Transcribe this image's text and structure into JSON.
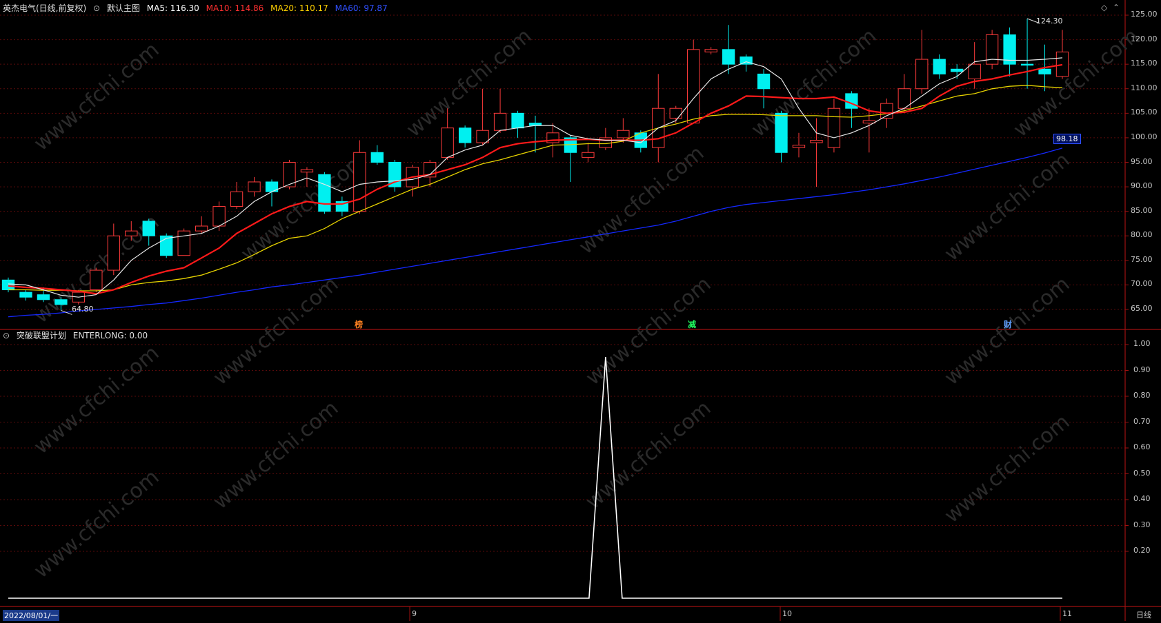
{
  "header": {
    "stock": "英杰电气(日线,前复权)",
    "indicator_name": "默认主图",
    "ma5": {
      "label": "MA5: 116.30",
      "color": "#ffffff"
    },
    "ma10": {
      "label": "MA10: 114.86",
      "color": "#ff2020"
    },
    "ma20": {
      "label": "MA20: 110.17",
      "color": "#ffd000"
    },
    "ma60": {
      "label": "MA60: 97.87",
      "color": "#2040ff"
    }
  },
  "sub_header": {
    "indicator": "突破联盟计划",
    "value_label": "ENTERLONG: 0.00"
  },
  "markers": {
    "high": "124.30",
    "low": "64.80",
    "current_price": "98.18"
  },
  "event_tags": [
    "榜",
    "减",
    "财"
  ],
  "price_axis": [
    "125.00",
    "120.00",
    "115.00",
    "110.00",
    "105.00",
    "100.00",
    "95.00",
    "90.00",
    "85.00",
    "80.00",
    "75.00",
    "70.00",
    "65.00"
  ],
  "indicator_axis": [
    "1.00",
    "0.90",
    "0.80",
    "0.70",
    "0.60",
    "0.50",
    "0.40",
    "0.30",
    "0.20"
  ],
  "date_axis": {
    "start": "2022/08/01/一",
    "m9": "9",
    "m10": "10",
    "m11": "11",
    "period": "日线"
  },
  "watermark": "www.cfchi.com",
  "chart_data": {
    "type": "candlestick",
    "ylim": [
      62,
      126
    ],
    "candles": [
      [
        71.0,
        69.0,
        71.5,
        68.5
      ],
      [
        68.5,
        67.5,
        69.0,
        66.8
      ],
      [
        68.0,
        67.0,
        69.5,
        66.5
      ],
      [
        67.0,
        66.0,
        67.5,
        64.8
      ],
      [
        66.5,
        68.5,
        69.0,
        66.0
      ],
      [
        69.0,
        73.0,
        73.5,
        68.5
      ],
      [
        73.0,
        80.0,
        82.5,
        72.0
      ],
      [
        80.0,
        81.0,
        83.0,
        79.0
      ],
      [
        83.0,
        80.0,
        83.5,
        78.0
      ],
      [
        80.0,
        76.0,
        80.5,
        75.5
      ],
      [
        76.0,
        81.0,
        81.5,
        76.0
      ],
      [
        81.0,
        82.0,
        84.0,
        80.5
      ],
      [
        82.0,
        86.0,
        87.0,
        81.0
      ],
      [
        86.0,
        89.0,
        91.0,
        85.5
      ],
      [
        89.0,
        91.0,
        92.0,
        88.0
      ],
      [
        91.0,
        89.0,
        91.5,
        86.0
      ],
      [
        90.0,
        95.0,
        95.5,
        89.5
      ],
      [
        93.0,
        93.5,
        94.0,
        90.0
      ],
      [
        92.5,
        85.0,
        93.0,
        84.5
      ],
      [
        87.0,
        85.0,
        88.0,
        84.0
      ],
      [
        85.0,
        97.0,
        99.5,
        84.5
      ],
      [
        97.0,
        95.0,
        98.5,
        94.5
      ],
      [
        95.0,
        90.0,
        95.5,
        89.0
      ],
      [
        90.0,
        94.0,
        94.5,
        88.0
      ],
      [
        92.0,
        95.0,
        95.5,
        90.0
      ],
      [
        96.0,
        102.0,
        106.0,
        95.5
      ],
      [
        102.0,
        99.0,
        102.5,
        98.0
      ],
      [
        99.0,
        101.5,
        110.0,
        98.5
      ],
      [
        101.5,
        105.0,
        110.0,
        101.0
      ],
      [
        105.0,
        102.0,
        105.5,
        100.0
      ],
      [
        103.0,
        102.5,
        104.5,
        97.0
      ],
      [
        99.0,
        101.0,
        103.0,
        96.0
      ],
      [
        100.0,
        97.0,
        100.5,
        91.0
      ],
      [
        96.0,
        97.0,
        99.0,
        95.0
      ],
      [
        98.0,
        100.0,
        102.0,
        97.5
      ],
      [
        100.0,
        101.5,
        104.0,
        99.0
      ],
      [
        101.0,
        98.0,
        101.5,
        97.0
      ],
      [
        98.0,
        106.0,
        113.0,
        95.0
      ],
      [
        104.0,
        106.0,
        106.5,
        103.0
      ],
      [
        103.0,
        118.0,
        120.0,
        103.0
      ],
      [
        117.5,
        118.0,
        118.5,
        117.0
      ],
      [
        118.0,
        115.0,
        123.0,
        113.0
      ],
      [
        116.5,
        115.0,
        117.0,
        113.5
      ],
      [
        113.0,
        110.0,
        114.0,
        106.0
      ],
      [
        105.0,
        97.0,
        105.5,
        95.0
      ],
      [
        98.0,
        98.5,
        101.0,
        96.0
      ],
      [
        99.0,
        99.5,
        104.0,
        90.0
      ],
      [
        98.0,
        106.0,
        108.0,
        97.0
      ],
      [
        109.0,
        106.0,
        109.5,
        102.0
      ],
      [
        103.0,
        103.5,
        106.0,
        97.0
      ],
      [
        104.0,
        107.0,
        108.0,
        102.0
      ],
      [
        106.0,
        110.0,
        113.0,
        105.5
      ],
      [
        110.0,
        116.0,
        122.0,
        109.0
      ],
      [
        116.0,
        113.0,
        117.0,
        112.0
      ],
      [
        114.0,
        113.5,
        115.0,
        112.0
      ],
      [
        112.0,
        115.0,
        119.5,
        110.0
      ],
      [
        115.0,
        121.0,
        122.0,
        114.0
      ],
      [
        121.0,
        115.0,
        122.5,
        112.5
      ],
      [
        115.0,
        114.8,
        124.3,
        110.0
      ],
      [
        114.0,
        113.0,
        119.0,
        109.5
      ],
      [
        112.5,
        117.5,
        122.0,
        112.0
      ]
    ],
    "ma5": [
      70.2,
      70.0,
      69.0,
      67.9,
      67.5,
      68.0,
      71.0,
      75.0,
      77.5,
      79.5,
      80.0,
      80.5,
      82.0,
      84.0,
      87.0,
      89.0,
      90.5,
      91.8,
      90.5,
      89.0,
      90.5,
      91.0,
      91.2,
      91.5,
      92.5,
      96.0,
      97.5,
      98.5,
      101.5,
      102.0,
      102.5,
      102.5,
      100.5,
      99.8,
      99.5,
      99.5,
      99.0,
      102.0,
      103.5,
      108.0,
      112.0,
      114.0,
      115.5,
      114.5,
      112.0,
      106.0,
      101.0,
      100.0,
      101.0,
      102.5,
      104.5,
      106.0,
      108.5,
      111.0,
      112.5,
      115.5,
      116.0,
      115.8,
      115.8,
      116.0,
      116.3
    ],
    "ma10": [
      69.8,
      69.5,
      69.3,
      69.0,
      68.7,
      68.2,
      69.0,
      70.5,
      71.8,
      72.8,
      73.5,
      75.5,
      77.5,
      80.5,
      82.5,
      84.5,
      86.0,
      87.0,
      86.5,
      86.5,
      87.5,
      89.5,
      91.0,
      92.0,
      92.5,
      93.5,
      94.5,
      96.0,
      98.0,
      98.8,
      99.2,
      99.5,
      99.6,
      99.7,
      99.5,
      99.5,
      99.5,
      99.8,
      101.0,
      103.0,
      105.0,
      106.5,
      108.5,
      108.4,
      108.2,
      108.0,
      108.0,
      108.3,
      107.0,
      105.5,
      105.0,
      105.2,
      106.0,
      108.5,
      110.5,
      111.5,
      112.0,
      112.8,
      113.5,
      114.3,
      114.9
    ],
    "ma20": [
      69.0,
      69.0,
      68.9,
      68.9,
      68.8,
      68.8,
      69.0,
      70.0,
      70.5,
      70.8,
      71.3,
      72.0,
      73.2,
      74.5,
      76.2,
      78.0,
      79.5,
      80.0,
      81.5,
      83.5,
      85.0,
      86.5,
      88.0,
      89.5,
      90.5,
      92.0,
      93.5,
      94.7,
      95.5,
      96.5,
      97.5,
      98.5,
      98.6,
      98.8,
      98.8,
      99.3,
      101.0,
      102.0,
      102.8,
      103.8,
      104.5,
      104.8,
      104.8,
      104.7,
      104.5,
      104.5,
      104.5,
      104.3,
      104.2,
      104.5,
      104.9,
      105.5,
      106.5,
      107.5,
      108.5,
      109.0,
      110.0,
      110.5,
      110.7,
      110.4,
      110.2
    ],
    "ma60": [
      63.5,
      63.8,
      64.0,
      64.3,
      64.7,
      65.0,
      65.3,
      65.6,
      66.0,
      66.3,
      66.8,
      67.3,
      67.9,
      68.5,
      69.0,
      69.6,
      70.0,
      70.5,
      71.0,
      71.5,
      72.0,
      72.6,
      73.2,
      73.8,
      74.4,
      75.0,
      75.6,
      76.2,
      76.8,
      77.4,
      78.0,
      78.6,
      79.2,
      79.8,
      80.4,
      81.0,
      81.6,
      82.2,
      83.0,
      84.0,
      85.0,
      85.8,
      86.4,
      86.8,
      87.2,
      87.6,
      88.0,
      88.4,
      88.9,
      89.4,
      90.0,
      90.6,
      91.3,
      92.0,
      92.8,
      93.6,
      94.4,
      95.2,
      96.0,
      96.9,
      97.9
    ],
    "indicator": {
      "name": "ENTERLONG",
      "ylim": [
        0,
        1.05
      ],
      "spike_index": 34,
      "spike_value": 1.0,
      "baseline": 0.0
    }
  }
}
